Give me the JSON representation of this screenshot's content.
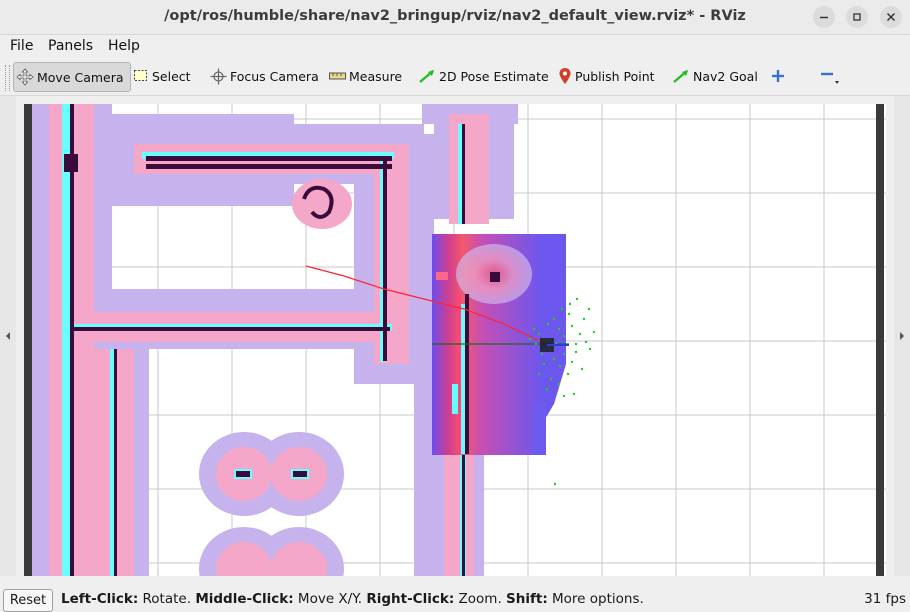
{
  "window": {
    "title": "/opt/ros/humble/share/nav2_bringup/rviz/nav2_default_view.rviz* - RViz",
    "controls": [
      "minimize",
      "maximize",
      "close"
    ]
  },
  "menu": {
    "file": "File",
    "panels": "Panels",
    "help": "Help"
  },
  "toolbar": {
    "move_camera": "Move Camera",
    "select": "Select",
    "focus_camera": "Focus Camera",
    "measure": "Measure",
    "pose_estimate": "2D Pose Estimate",
    "publish_point": "Publish Point",
    "nav2_goal": "Nav2 Goal",
    "active_tool": "Move Camera"
  },
  "colors": {
    "inflation_light": "#c8b3ec",
    "inflation_pink": "#f08ab0",
    "obstacle_dark": "#3a0a3a",
    "cyan_edge": "#66ffff",
    "local_costmap": "#7c5cf0",
    "laser_points": "#22cc22",
    "path": "#ff2233"
  },
  "status": {
    "reset": "Reset",
    "hint": [
      {
        "key": "Left-Click:",
        "text": " Rotate. "
      },
      {
        "key": "Middle-Click:",
        "text": " Move X/Y. "
      },
      {
        "key": "Right-Click:",
        "text": " Zoom. "
      },
      {
        "key": "Shift:",
        "text": " More options."
      }
    ],
    "fps": "31 fps"
  }
}
